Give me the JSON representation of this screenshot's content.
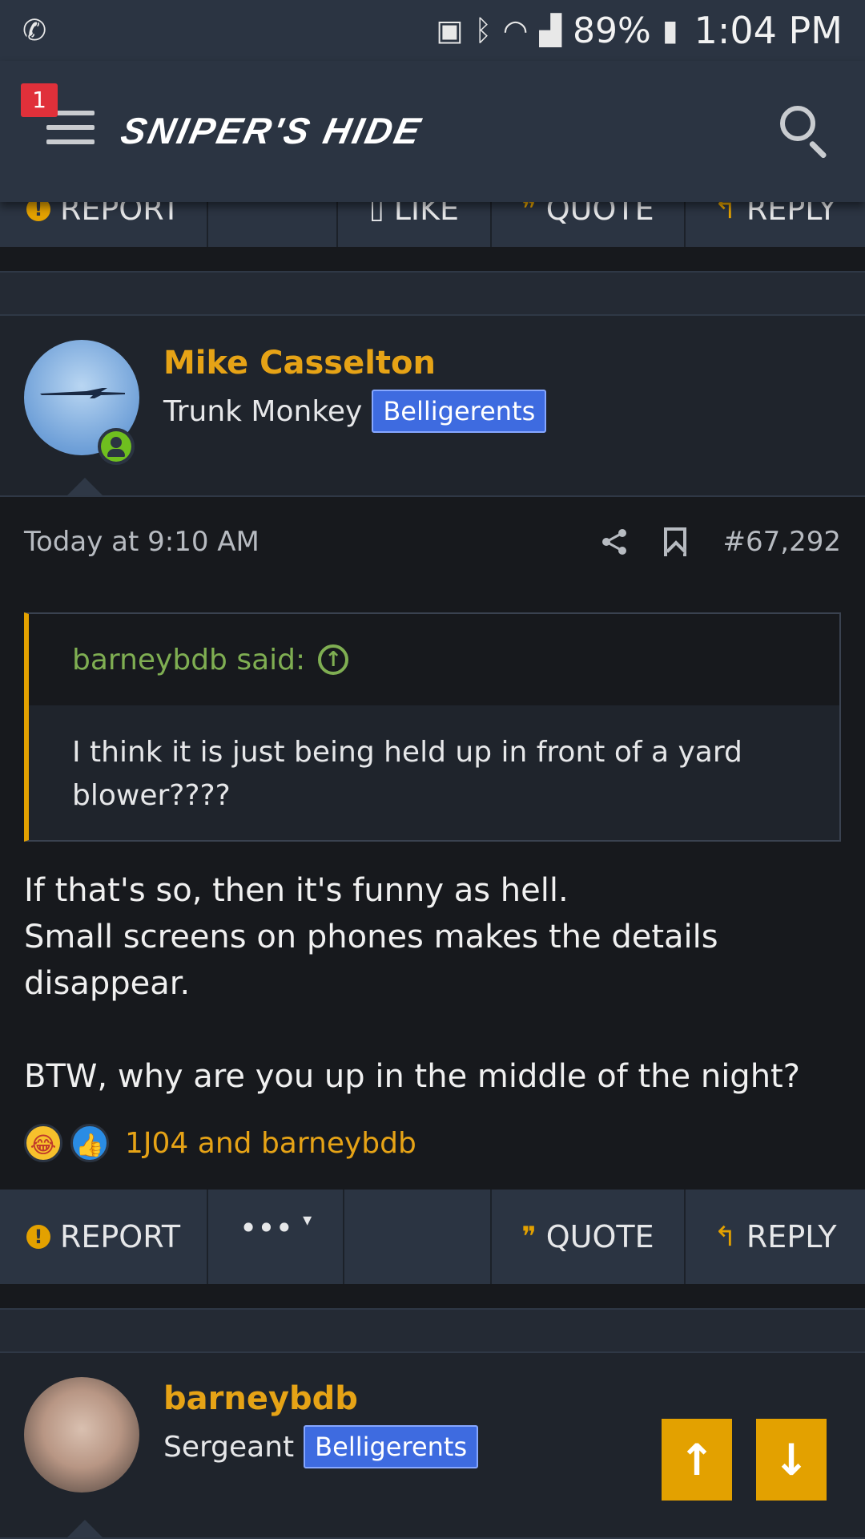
{
  "status_bar": {
    "battery": "89%",
    "time": "1:04 PM"
  },
  "header": {
    "notification_count": "1",
    "logo_text": "SNIPER'S HIDE"
  },
  "top_actions": {
    "report": "REPORT",
    "like": "LIKE",
    "quote": "QUOTE",
    "reply": "REPLY"
  },
  "post": {
    "author": "Mike Casselton",
    "author_title": "Trunk Monkey",
    "author_badge": "Belligerents",
    "timestamp": "Today at 9:10 AM",
    "post_number": "#67,292",
    "quote": {
      "author_line": "barneybdb said:",
      "text": "I think it is just being held up in front of a yard blower????"
    },
    "body_lines": [
      "If that's so, then it's funny as hell.",
      "Small screens on phones makes the details disappear.",
      "BTW, why are you up in the middle of the night?"
    ],
    "reactions_text": "1J04 and barneybdb",
    "actions": {
      "report": "REPORT",
      "more": "•••",
      "quote": "QUOTE",
      "reply": "REPLY"
    }
  },
  "next_post": {
    "author": "barneybdb",
    "author_title": "Sergeant",
    "author_badge": "Belligerents"
  },
  "colors": {
    "accent": "#e3a100",
    "username": "#e6a316",
    "badge": "#3e6be0",
    "quote_green": "#7fae52",
    "header_bg": "#2b3442"
  }
}
